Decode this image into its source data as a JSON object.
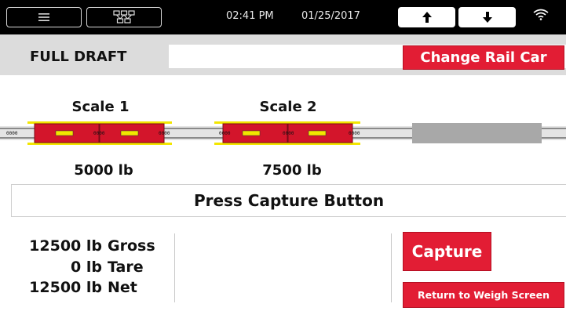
{
  "topbar": {
    "time": "02:41 PM",
    "date": "01/25/2017",
    "icons": [
      "menu-icon",
      "network-icon",
      "arrow-up-icon",
      "arrow-down-icon",
      "wifi-icon"
    ]
  },
  "header": {
    "title": "FULL DRAFT",
    "car_field_value": "",
    "change_button_label": "Change Rail Car"
  },
  "scales": [
    {
      "title": "Scale 1",
      "weight": "5000 lb"
    },
    {
      "title": "Scale 2",
      "weight": "7500 lb"
    }
  ],
  "car_label_small": "0000",
  "prompt": "Press Capture Button",
  "totals": [
    {
      "value": "12500 lb",
      "label": "Gross"
    },
    {
      "value": "0 lb",
      "label": "Tare"
    },
    {
      "value": "12500 lb",
      "label": "Net"
    }
  ],
  "buttons": {
    "capture": "Capture",
    "return": "Return to Weigh Screen"
  },
  "colors": {
    "accent_red": "#e21d34",
    "scale_yellow": "#f2e600",
    "header_gray": "#dcdcdc"
  }
}
